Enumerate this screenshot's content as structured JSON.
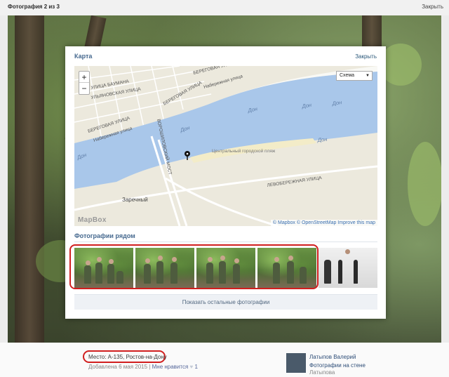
{
  "topbar": {
    "counter": "Фотография 2 из 3",
    "close": "Закрыть"
  },
  "modal": {
    "title": "Карта",
    "close": "Закрыть",
    "map": {
      "zoom_in": "+",
      "zoom_out": "−",
      "layer_select": "Схема",
      "attribution": "© Mapbox © OpenStreetMap Improve this map",
      "brand": "MapBox",
      "labels": {
        "street1": "УЛИЦА БАУМАНА",
        "street2": "УЛЬЯНОВСКАЯ УЛИЦА",
        "street3": "БЕРЕГОВАЯ УЛИЦА",
        "street4": "Набережная улица",
        "street5": "БЕРЕГОВАЯ УЛИЦА",
        "street6": "Набережная улица",
        "street7": "БЕРЕГОВАЯ УЛИЦА",
        "bridge": "ВОРОШИЛОВСКИЙ МОСТ",
        "river1": "Дон",
        "river2": "Дон",
        "river3": "Дон",
        "river4": "Дон",
        "river5": "Дон",
        "river6": "Дон",
        "beach": "Центральный городской пляж",
        "left_bank": "ЛЕВОБЕРЕЖНАЯ УЛИЦА",
        "district": "Заречный"
      }
    },
    "nearby_title": "Фотографии рядом",
    "show_more": "Показать остальные фотографии"
  },
  "info": {
    "place": "Место: А-135, Ростов-на-Дону",
    "added": "Добавлена 6 мая 2015",
    "separator": "|",
    "like": "Мне нравится",
    "likes_count": "1"
  },
  "author": {
    "name": "Латыпов Валерий",
    "album": "Фотографии на стене",
    "album_owner": "Латыпова"
  },
  "colors": {
    "accent": "#45688e",
    "highlight_ring": "#d11f1f",
    "water": "#a9c7ea",
    "land": "#ece9dd"
  }
}
